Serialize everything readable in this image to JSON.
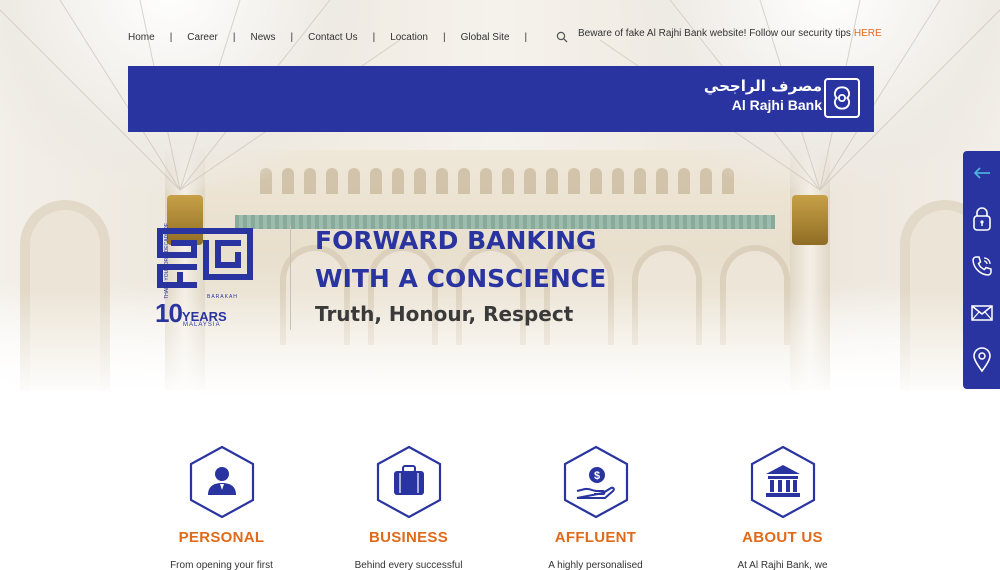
{
  "nav": {
    "items": [
      "Home",
      "Career",
      "News",
      "Contact Us",
      "Location",
      "Global Site"
    ],
    "separator": "|",
    "search_icon": "search-icon"
  },
  "notice": {
    "text": "Beware of fake Al Rajhi Bank website! Follow our security tips",
    "link": "HERE"
  },
  "brand": {
    "arabic": "مصرف الراجحي",
    "english": "Al Rajhi Bank"
  },
  "barakah": {
    "thanks": "THANK YOU FOR A DECADE OF",
    "word": "BARAKAH",
    "years_num": "10",
    "years_word": "YEARS",
    "country": "MALAYSIA"
  },
  "hero": {
    "title_line1": "FORWARD BANKING",
    "title_line2": "WITH A CONSCIENCE",
    "subtitle": "Truth, Honour, Respect"
  },
  "sidebar": {
    "items": [
      "arrow-left-icon",
      "lock-icon",
      "phone-icon",
      "mail-icon",
      "location-pin-icon"
    ]
  },
  "features": [
    {
      "title": "PERSONAL",
      "desc": "From opening your first",
      "icon": "person-icon"
    },
    {
      "title": "BUSINESS",
      "desc": "Behind every successful",
      "icon": "briefcase-icon"
    },
    {
      "title": "AFFLUENT",
      "desc": "A highly personalised",
      "icon": "money-hand-icon"
    },
    {
      "title": "ABOUT US",
      "desc": "At Al Rajhi Bank, we",
      "icon": "bank-building-icon"
    }
  ],
  "colors": {
    "brand_blue": "#2934a0",
    "accent_orange": "#e06a1a"
  }
}
